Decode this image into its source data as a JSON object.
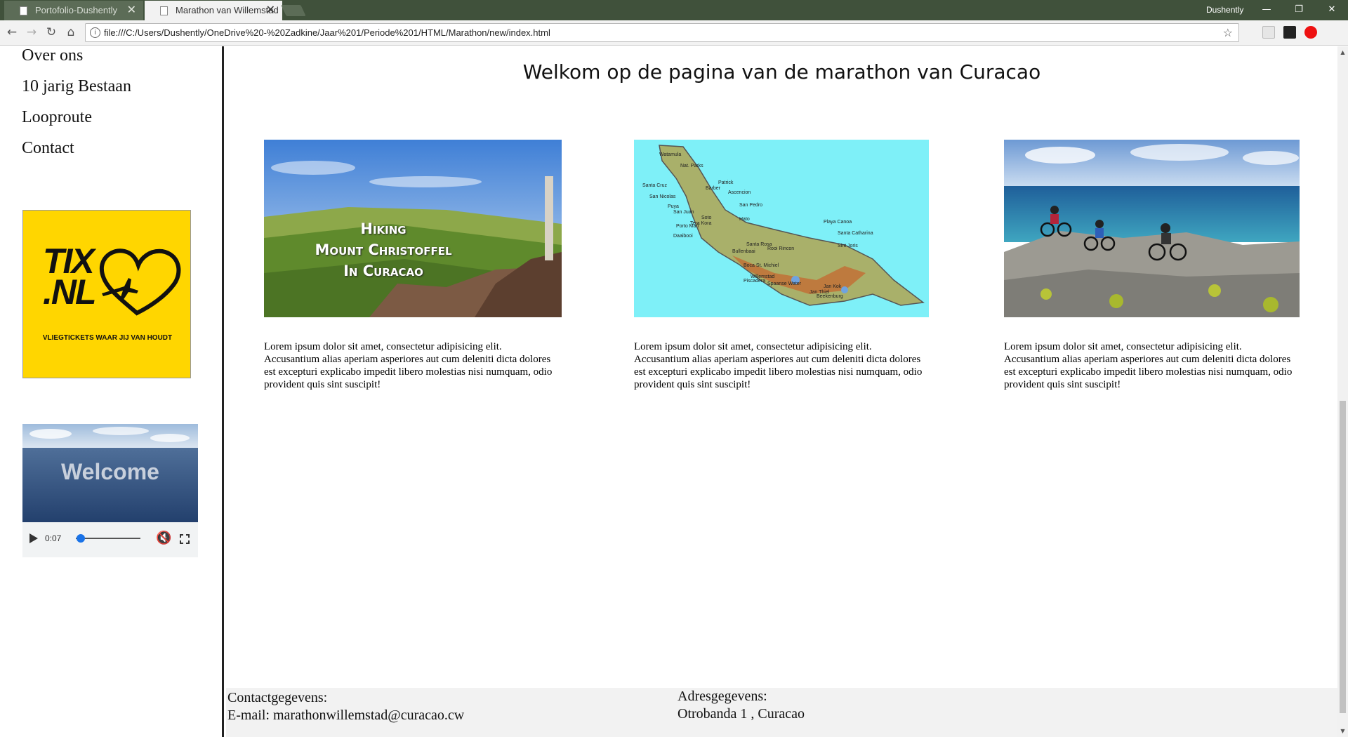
{
  "browser": {
    "tabs": [
      {
        "title": "Portofolio-Dushently",
        "active": false
      },
      {
        "title": "Marathon van Willemstad",
        "active": true
      }
    ],
    "profile_name": "Dushently",
    "address": "file:///C:/Users/Dushently/OneDrive%20-%20Zadkine/Jaar%201/Periode%201/HTML/Marathon/new/index.html",
    "icons": {
      "back": "back-arrow-icon",
      "forward": "forward-arrow-icon",
      "reload": "reload-icon",
      "home": "home-icon",
      "info": "info-icon",
      "bookmark": "star-icon",
      "minimize": "minimize-icon",
      "restore": "restore-icon",
      "close": "close-icon"
    },
    "extensions": [
      "page-extension-icon",
      "jb-extension-icon",
      "opera-extension-icon"
    ],
    "accent_color": "#40513b"
  },
  "sidebar": {
    "nav": [
      {
        "label": "Over ons"
      },
      {
        "label": "10 jarig Bestaan"
      },
      {
        "label": "Looproute"
      },
      {
        "label": "Contact"
      }
    ],
    "ad": {
      "logo_top": "TIX",
      "logo_bottom": ".NL",
      "tagline": "VLIEGTICKETS WAAR JIJ VAN HOUDT",
      "bg_color": "#ffd600"
    },
    "video": {
      "overlay_text": "Welcome",
      "time": "0:07",
      "progress": 0.05,
      "muted": true
    }
  },
  "main": {
    "title": "Welkom op de pagina van de marathon van Curacao",
    "cards": [
      {
        "image": {
          "type": "photo",
          "caption_lines": [
            "Hiking",
            "Mount Christoffel",
            "In Curacao"
          ]
        },
        "text": "Lorem ipsum dolor sit amet, consectetur adipisicing elit. Accusantium alias aperiam asperiores aut cum deleniti dicta dolores est excepturi explicabo impedit libero molestias nisi numquam, odio provident quis sint suscipit!"
      },
      {
        "image": {
          "type": "map",
          "place_labels": [
            "Watamula",
            "Nat. Parks",
            "Patrick",
            "Santa Cruz",
            "Barber",
            "San Nicolas",
            "Ascencion",
            "Puya",
            "San Juan",
            "San Pedro",
            "Soto",
            "Tera Kora",
            "Porto Mari",
            "Daaibooi",
            "Hato",
            "Playa Canoa",
            "Bullenbaai",
            "Santa Rosa",
            "Rooi Rincon",
            "Santa Catharina",
            "Boca St. Michiel",
            "Willemstad",
            "Spaanse Water",
            "Jan Thiel",
            "Piscadera",
            "Sint Joris",
            "Jan Kok",
            "Beekenburg"
          ]
        },
        "text": "Lorem ipsum dolor sit amet, consectetur adipisicing elit. Accusantium alias aperiam asperiores aut cum deleniti dicta dolores est excepturi explicabo impedit libero molestias nisi numquam, odio provident quis sint suscipit!"
      },
      {
        "image": {
          "type": "photo",
          "subject": "mountain bikers on rocky coast"
        },
        "text": "Lorem ipsum dolor sit amet, consectetur adipisicing elit. Accusantium alias aperiam asperiores aut cum deleniti dicta dolores est excepturi explicabo impedit libero molestias nisi numquam, odio provident quis sint suscipit!"
      }
    ]
  },
  "footer": {
    "contact_heading": "Contactgegevens:",
    "contact_email": "E-mail: marathonwillemstad@curacao.cw",
    "address_heading": "Adresgegevens:",
    "address_line": "Otrobanda 1 , Curacao"
  }
}
